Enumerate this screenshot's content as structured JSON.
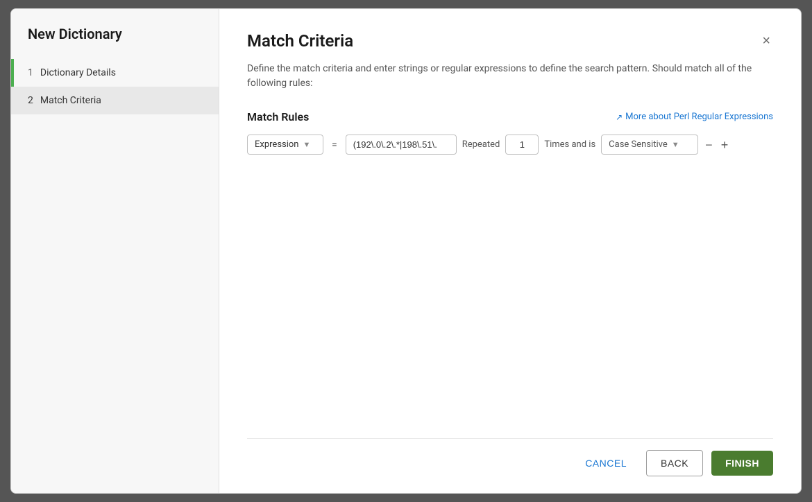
{
  "dialog": {
    "sidebar": {
      "title": "New Dictionary",
      "steps": [
        {
          "num": "1",
          "label": "Dictionary Details",
          "active": false,
          "completed": true
        },
        {
          "num": "2",
          "label": "Match Criteria",
          "active": true,
          "completed": false
        }
      ]
    },
    "main": {
      "title": "Match Criteria",
      "close_label": "×",
      "description": "Define the match criteria and enter strings or regular expressions to define the search pattern. Should match all of the following rules:",
      "match_rules": {
        "section_title": "Match Rules",
        "perl_link_text": "More about Perl Regular Expressions",
        "rule": {
          "expression_label": "Expression",
          "equals": "=",
          "expression_value": "(192\\.0\\.2\\.*|198\\.51\\.",
          "repeated_label": "Repeated",
          "times_value": "1",
          "times_and_is": "Times and is",
          "case_sensitive_placeholder": "Case Sensitive"
        }
      },
      "footer": {
        "cancel_label": "CANCEL",
        "back_label": "BACK",
        "finish_label": "FINISH"
      }
    }
  }
}
